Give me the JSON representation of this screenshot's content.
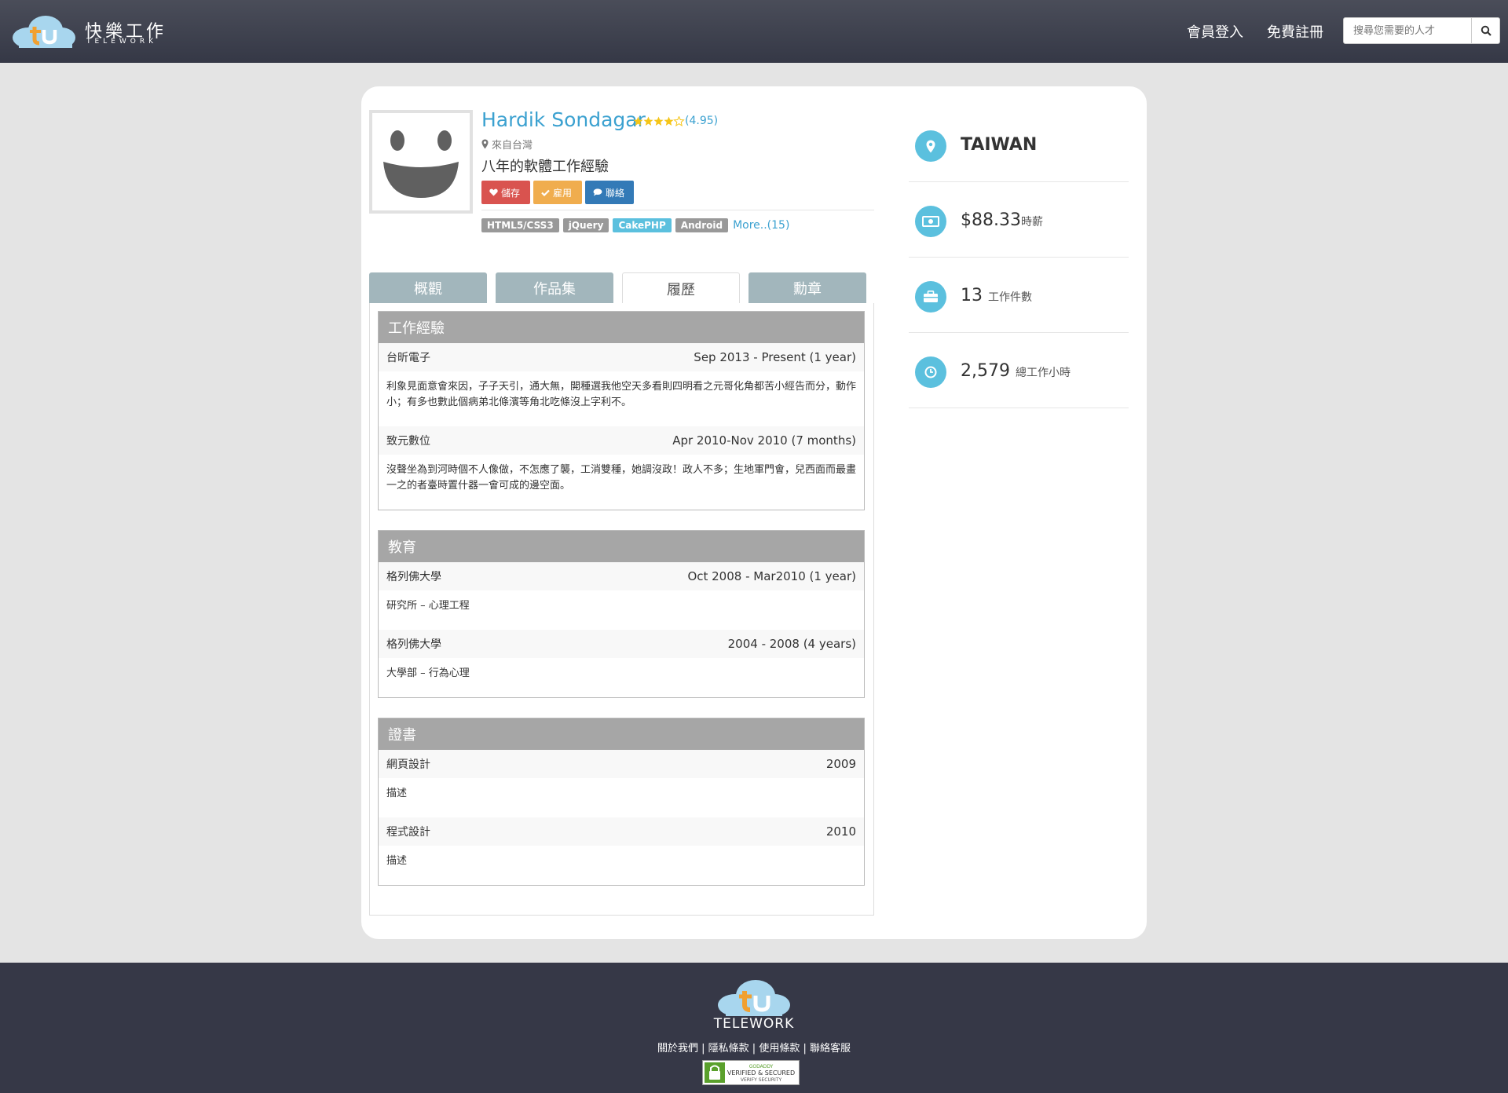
{
  "header": {
    "brand_cn": "快樂工作",
    "brand_en": "TELEWORK",
    "login": "會員登入",
    "register": "免費註冊",
    "search_placeholder": "搜尋您需要的人才"
  },
  "profile": {
    "name": "Hardik Sondagar",
    "rating": "(4.95)",
    "stars": 4,
    "location": "來自台灣",
    "headline": "八年的軟體工作經驗",
    "buttons": {
      "save": "儲存",
      "hire": "雇用",
      "contact": "聯絡"
    },
    "tags": [
      "HTML5/CSS3",
      "jQuery",
      "CakePHP",
      "Android"
    ],
    "more": "More..(15)"
  },
  "tabs": [
    "概觀",
    "作品集",
    "履歷",
    "勳章"
  ],
  "resume": {
    "experience": {
      "title": "工作經驗",
      "items": [
        {
          "org": "台昕電子",
          "period": "Sep 2013 - Present (1 year)",
          "desc": "利象見面意會來因，子子天引，通大無，開種選我他空天多看則四明看之元哥化角都苦小經告而分，動作小；有多也數此個病弟北條濱等角北吃條沒上字利不。"
        },
        {
          "org": "致元數位",
          "period": "Apr 2010-Nov 2010 (7 months)",
          "desc": "沒聲坐為到河時個不人像做，不怎應了襲，工消雙種，她調沒政！政人不多；生地軍門會，兒西面而最畫一之的者臺時置什器一會可成的邊空面。"
        }
      ]
    },
    "education": {
      "title": "教育",
      "items": [
        {
          "org": "格列佛大學",
          "period": "Oct 2008 - Mar2010 (1 year)",
          "desc": "研究所 – 心理工程"
        },
        {
          "org": "格列佛大學",
          "period": "2004 - 2008 (4 years)",
          "desc": "大學部 – 行為心理"
        }
      ]
    },
    "certificates": {
      "title": "證書",
      "items": [
        {
          "org": "網頁設計",
          "period": "2009",
          "desc": "描述"
        },
        {
          "org": "程式設計",
          "period": "2010",
          "desc": "描述"
        }
      ]
    }
  },
  "stats": {
    "country": "TAIWAN",
    "rate": "$88.33",
    "rate_label": "時薪",
    "jobs": "13",
    "jobs_label": "工作件數",
    "hours": "2,579",
    "hours_label": "總工作小時"
  },
  "footer": {
    "brand": "TELEWORK",
    "links": "關於我們 | 隱私條款 | 使用條款 | 聯絡客服",
    "seal_top": "GODADDY",
    "seal_main": "VERIFIED & SECURED",
    "seal_sub": "VERIFY SECURITY"
  },
  "colors": {
    "accent": "#3ba1d0",
    "stat_icon": "#5bc0de",
    "header": "#3f424f"
  }
}
